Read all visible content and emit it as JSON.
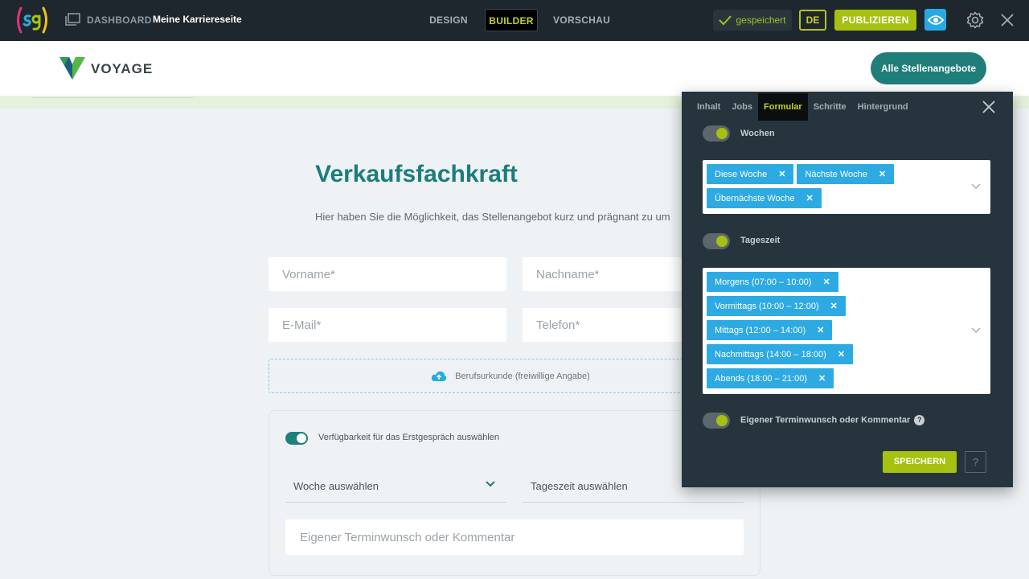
{
  "topbar": {
    "dashboard_label": "DASHBOARD",
    "site_name": "Meine Karriereseite",
    "modes": {
      "design": "DESIGN",
      "builder": "BUILDER",
      "preview": "VORSCHAU"
    },
    "saved_label": "gespeichert",
    "language": "DE",
    "publish_label": "PUBLIZIEREN",
    "colors": {
      "background": "#1e272e",
      "accent": "#a6c10f",
      "eye_button": "#29a9e1"
    }
  },
  "site": {
    "brand": "VOYAGE",
    "all_jobs_button": "Alle Stellenangebote",
    "job_title": "Verkaufsfachkraft",
    "job_subtitle": "Hier haben Sie die Möglichkeit, das Stellenangebot kurz und prägnant zu um",
    "form": {
      "first_name_placeholder": "Vorname*",
      "last_name_placeholder": "Nachname*",
      "email_placeholder": "E-Mail*",
      "phone_placeholder": "Telefon*",
      "upload_label": "Berufsurkunde (freiwillige Angabe)",
      "availability_label": "Verfügbarkeit für das Erstgespräch auswählen",
      "week_select": "Woche auswählen",
      "time_select": "Tageszeit auswählen",
      "comment_placeholder": "Eigener Terminwunsch oder Kommentar"
    },
    "colors": {
      "brand_teal": "#1c7d79"
    }
  },
  "panel": {
    "tabs": [
      "Inhalt",
      "Jobs",
      "Formular",
      "Schritte",
      "Hintergrund"
    ],
    "active_tab": "Formular",
    "weeks": {
      "label": "Wochen",
      "enabled": true,
      "chips": [
        "Diese Woche",
        "Nächste Woche",
        "Übernächste Woche"
      ]
    },
    "daytime": {
      "label": "Tageszeit",
      "enabled": true,
      "chips": [
        "Morgens (07:00 – 10:00)",
        "Vormittags (10:00 – 12:00)",
        "Mittags (12:00 – 14:00)",
        "Nachmittags (14:00 – 18:00)",
        "Abends (18:00 – 21:00)"
      ]
    },
    "custom": {
      "label": "Eigener Terminwunsch oder Kommentar",
      "enabled": true,
      "help": "?"
    },
    "save_label": "SPEICHERN",
    "help_label": "?",
    "colors": {
      "background": "#26343d",
      "chip": "#2eaae3",
      "active_tab_text": "#c2d12a"
    }
  }
}
